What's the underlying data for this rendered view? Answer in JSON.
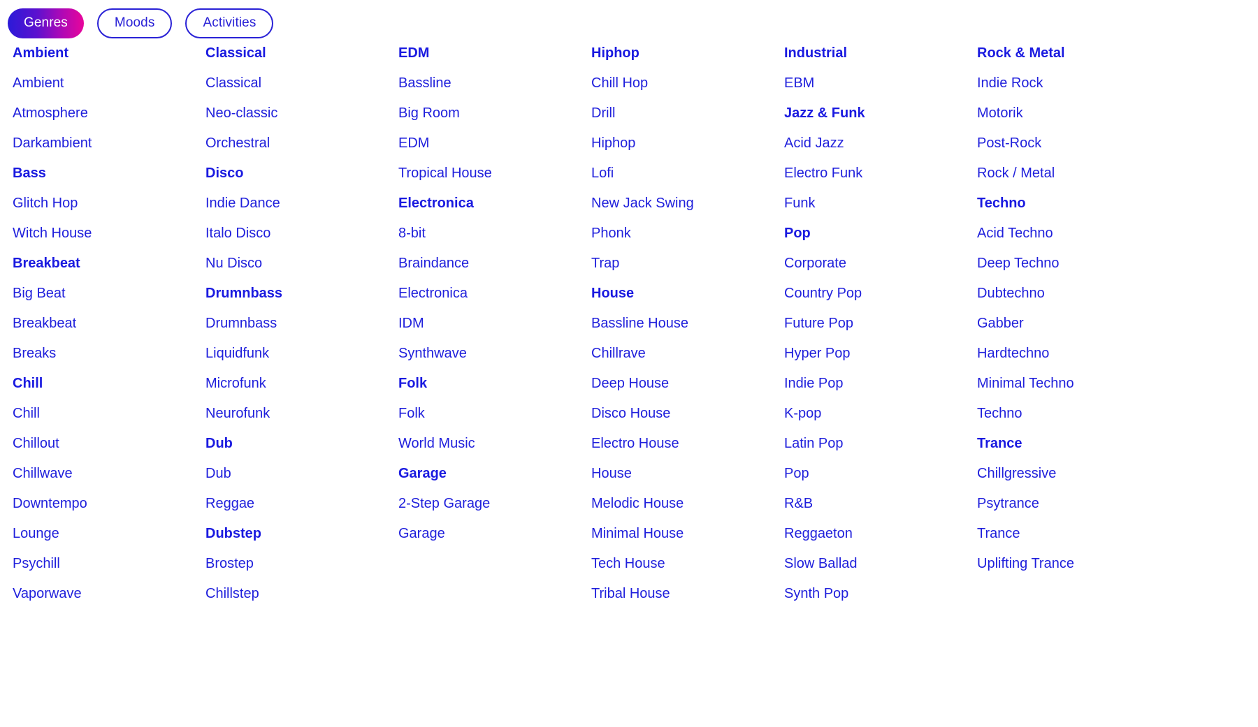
{
  "tabs": [
    {
      "label": "Genres",
      "active": true,
      "name": "tab-genres"
    },
    {
      "label": "Moods",
      "active": false,
      "name": "tab-moods"
    },
    {
      "label": "Activities",
      "active": false,
      "name": "tab-activities"
    }
  ],
  "colors": {
    "text_blue": "#2020dc",
    "group_blue": "#1a1ae0",
    "pill_border": "#2a22d6",
    "gradient_start": "#2b1ad8",
    "gradient_end": "#e8069b",
    "background": "#ffffff"
  },
  "columns": [
    {
      "name": "genre-column-1",
      "entries": [
        {
          "label": "Ambient",
          "type": "group"
        },
        {
          "label": "Ambient",
          "type": "item"
        },
        {
          "label": "Atmosphere",
          "type": "item"
        },
        {
          "label": "Darkambient",
          "type": "item"
        },
        {
          "label": "Bass",
          "type": "group"
        },
        {
          "label": "Glitch Hop",
          "type": "item"
        },
        {
          "label": "Witch House",
          "type": "item"
        },
        {
          "label": "Breakbeat",
          "type": "group"
        },
        {
          "label": "Big Beat",
          "type": "item"
        },
        {
          "label": "Breakbeat",
          "type": "item"
        },
        {
          "label": "Breaks",
          "type": "item"
        },
        {
          "label": "Chill",
          "type": "group"
        },
        {
          "label": "Chill",
          "type": "item"
        },
        {
          "label": "Chillout",
          "type": "item"
        },
        {
          "label": "Chillwave",
          "type": "item"
        },
        {
          "label": "Downtempo",
          "type": "item"
        },
        {
          "label": "Lounge",
          "type": "item"
        },
        {
          "label": "Psychill",
          "type": "item"
        },
        {
          "label": "Vaporwave",
          "type": "item"
        }
      ]
    },
    {
      "name": "genre-column-2",
      "entries": [
        {
          "label": "Classical",
          "type": "group"
        },
        {
          "label": "Classical",
          "type": "item"
        },
        {
          "label": "Neo-classic",
          "type": "item"
        },
        {
          "label": "Orchestral",
          "type": "item"
        },
        {
          "label": "Disco",
          "type": "group"
        },
        {
          "label": "Indie Dance",
          "type": "item"
        },
        {
          "label": "Italo Disco",
          "type": "item"
        },
        {
          "label": "Nu Disco",
          "type": "item"
        },
        {
          "label": "Drumnbass",
          "type": "group"
        },
        {
          "label": "Drumnbass",
          "type": "item"
        },
        {
          "label": "Liquidfunk",
          "type": "item"
        },
        {
          "label": "Microfunk",
          "type": "item"
        },
        {
          "label": "Neurofunk",
          "type": "item"
        },
        {
          "label": "Dub",
          "type": "group"
        },
        {
          "label": "Dub",
          "type": "item"
        },
        {
          "label": "Reggae",
          "type": "item"
        },
        {
          "label": "Dubstep",
          "type": "group"
        },
        {
          "label": "Brostep",
          "type": "item"
        },
        {
          "label": "Chillstep",
          "type": "item"
        }
      ]
    },
    {
      "name": "genre-column-3",
      "entries": [
        {
          "label": "EDM",
          "type": "group"
        },
        {
          "label": "Bassline",
          "type": "item"
        },
        {
          "label": "Big Room",
          "type": "item"
        },
        {
          "label": "EDM",
          "type": "item"
        },
        {
          "label": "Tropical House",
          "type": "item"
        },
        {
          "label": "Electronica",
          "type": "group"
        },
        {
          "label": "8-bit",
          "type": "item"
        },
        {
          "label": "Braindance",
          "type": "item"
        },
        {
          "label": "Electronica",
          "type": "item"
        },
        {
          "label": "IDM",
          "type": "item"
        },
        {
          "label": "Synthwave",
          "type": "item"
        },
        {
          "label": "Folk",
          "type": "group"
        },
        {
          "label": "Folk",
          "type": "item"
        },
        {
          "label": "World Music",
          "type": "item"
        },
        {
          "label": "Garage",
          "type": "group"
        },
        {
          "label": "2-Step Garage",
          "type": "item"
        },
        {
          "label": "Garage",
          "type": "item"
        }
      ]
    },
    {
      "name": "genre-column-4",
      "entries": [
        {
          "label": "Hiphop",
          "type": "group"
        },
        {
          "label": "Chill Hop",
          "type": "item"
        },
        {
          "label": "Drill",
          "type": "item"
        },
        {
          "label": "Hiphop",
          "type": "item"
        },
        {
          "label": "Lofi",
          "type": "item"
        },
        {
          "label": "New Jack Swing",
          "type": "item"
        },
        {
          "label": "Phonk",
          "type": "item"
        },
        {
          "label": "Trap",
          "type": "item"
        },
        {
          "label": "House",
          "type": "group"
        },
        {
          "label": "Bassline House",
          "type": "item"
        },
        {
          "label": "Chillrave",
          "type": "item"
        },
        {
          "label": "Deep House",
          "type": "item"
        },
        {
          "label": "Disco House",
          "type": "item"
        },
        {
          "label": "Electro House",
          "type": "item"
        },
        {
          "label": "House",
          "type": "item"
        },
        {
          "label": "Melodic House",
          "type": "item"
        },
        {
          "label": "Minimal House",
          "type": "item"
        },
        {
          "label": "Tech House",
          "type": "item"
        },
        {
          "label": "Tribal House",
          "type": "item"
        }
      ]
    },
    {
      "name": "genre-column-5",
      "entries": [
        {
          "label": "Industrial",
          "type": "group"
        },
        {
          "label": "EBM",
          "type": "item"
        },
        {
          "label": "Jazz & Funk",
          "type": "group"
        },
        {
          "label": "Acid Jazz",
          "type": "item"
        },
        {
          "label": "Electro Funk",
          "type": "item"
        },
        {
          "label": "Funk",
          "type": "item"
        },
        {
          "label": "Pop",
          "type": "group"
        },
        {
          "label": "Corporate",
          "type": "item"
        },
        {
          "label": "Country Pop",
          "type": "item"
        },
        {
          "label": "Future Pop",
          "type": "item"
        },
        {
          "label": "Hyper Pop",
          "type": "item"
        },
        {
          "label": "Indie Pop",
          "type": "item"
        },
        {
          "label": "K-pop",
          "type": "item"
        },
        {
          "label": "Latin Pop",
          "type": "item"
        },
        {
          "label": "Pop",
          "type": "item"
        },
        {
          "label": "R&B",
          "type": "item"
        },
        {
          "label": "Reggaeton",
          "type": "item"
        },
        {
          "label": "Slow Ballad",
          "type": "item"
        },
        {
          "label": "Synth Pop",
          "type": "item"
        }
      ]
    },
    {
      "name": "genre-column-6",
      "entries": [
        {
          "label": "Rock & Metal",
          "type": "group"
        },
        {
          "label": "Indie Rock",
          "type": "item"
        },
        {
          "label": "Motorik",
          "type": "item"
        },
        {
          "label": "Post-Rock",
          "type": "item"
        },
        {
          "label": "Rock / Metal",
          "type": "item"
        },
        {
          "label": "Techno",
          "type": "group"
        },
        {
          "label": "Acid Techno",
          "type": "item"
        },
        {
          "label": "Deep Techno",
          "type": "item"
        },
        {
          "label": "Dubtechno",
          "type": "item"
        },
        {
          "label": "Gabber",
          "type": "item"
        },
        {
          "label": "Hardtechno",
          "type": "item"
        },
        {
          "label": "Minimal Techno",
          "type": "item"
        },
        {
          "label": "Techno",
          "type": "item"
        },
        {
          "label": "Trance",
          "type": "group"
        },
        {
          "label": "Chillgressive",
          "type": "item"
        },
        {
          "label": "Psytrance",
          "type": "item"
        },
        {
          "label": "Trance",
          "type": "item"
        },
        {
          "label": "Uplifting Trance",
          "type": "item"
        }
      ]
    }
  ]
}
